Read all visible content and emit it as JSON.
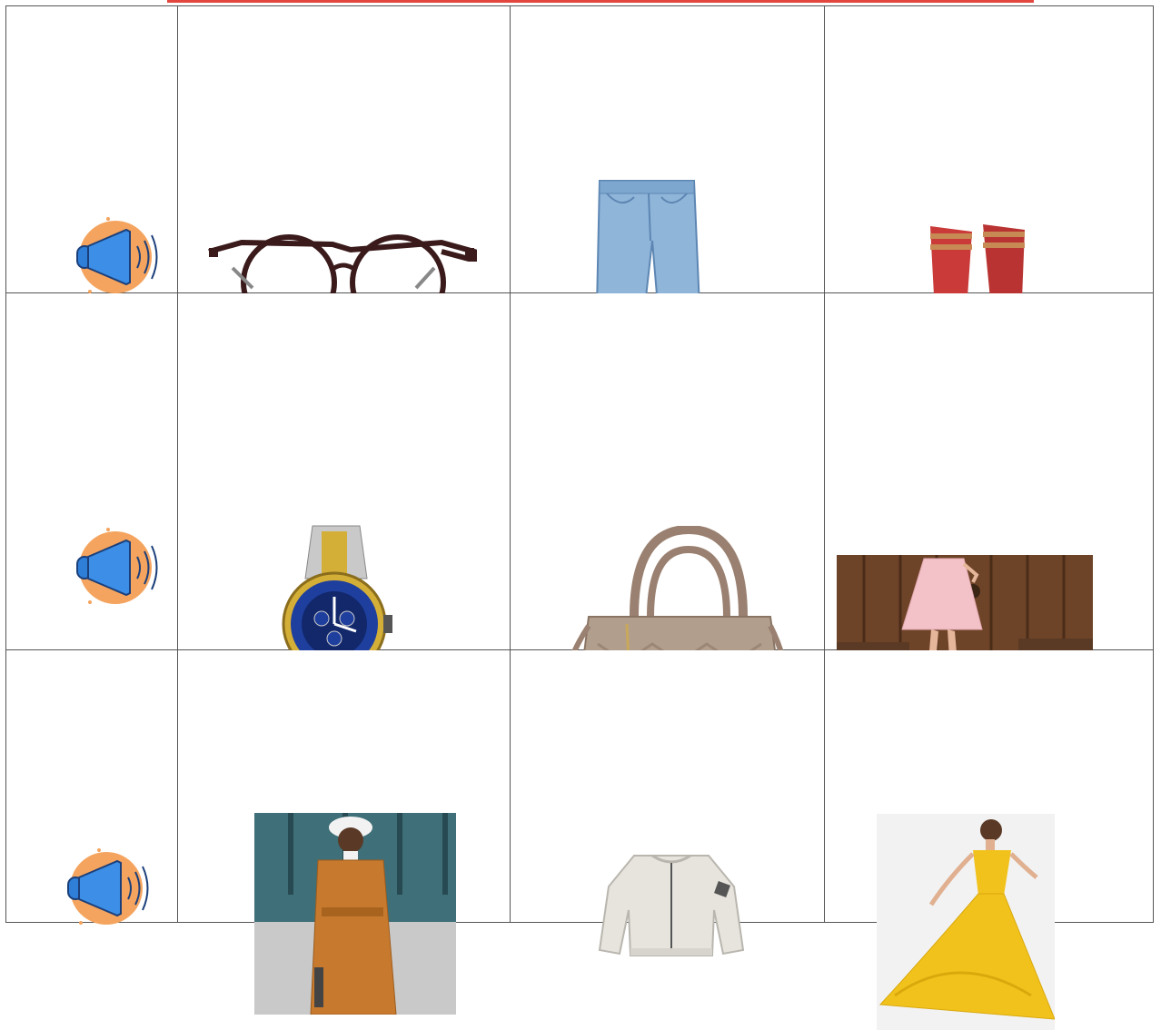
{
  "worksheet": {
    "rows": [
      {
        "audio_icon": "speaker-icon",
        "items": [
          "glasses-image",
          "jeans-image",
          "socks-image"
        ]
      },
      {
        "audio_icon": "speaker-icon",
        "items": [
          "watch-image",
          "handbag-image",
          "skirt-image"
        ]
      },
      {
        "audio_icon": "speaker-icon",
        "items": [
          "coat-image",
          "jacket-image",
          "dress-image"
        ]
      }
    ]
  },
  "colors": {
    "accent_rule": "#e2463f",
    "speaker_circle": "#f4a45e",
    "speaker_blue": "#2f7fd8",
    "grid_border": "#555555"
  }
}
